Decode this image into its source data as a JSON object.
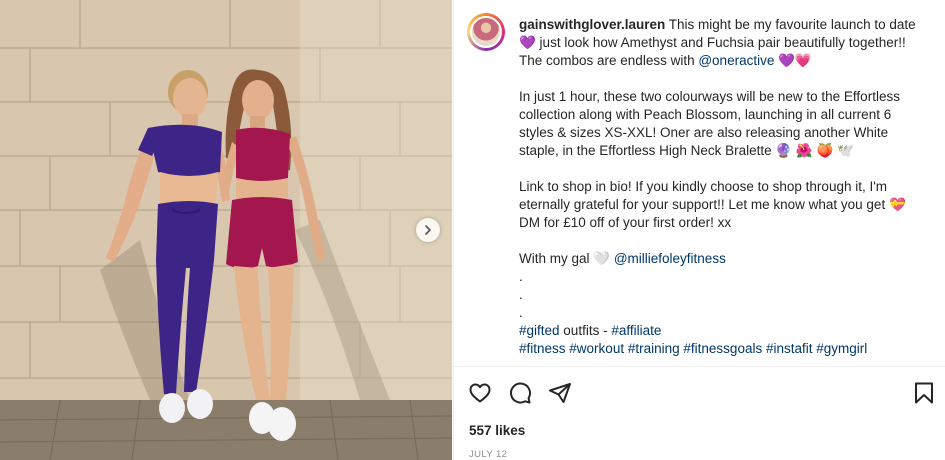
{
  "post": {
    "username": "gainswithglover.lauren",
    "caption_p1_text": " This might be my favourite launch to date 💜 just look how Amethyst and Fuchsia pair beautifully together!! The combos are endless with ",
    "mention_oner": "@oneractive",
    "caption_p1_end": " 💜💗",
    "caption_p2": "In just 1 hour, these two colourways will be new to the Effortless collection along with Peach Blossom, launching in all current 6 styles & sizes XS-XXL! Oner are also releasing another White staple, in the Effortless High Neck Bralette 🔮 🌺 🍑 🕊️",
    "caption_p3": "Link to shop in bio! If you kindly choose to shop through it, I'm eternally grateful for your support!! Let me know what you get 💝 DM for £10 off of your first order! xx",
    "gal_text": "With my gal 🤍 ",
    "mention_millie": "@milliefoleyfitness",
    "dot_1": ".",
    "dot_2": ".",
    "dot_3": ".",
    "tag_gifted": "#gifted",
    "gifted_mid": " outfits - ",
    "tag_affiliate": "#affiliate",
    "tags": [
      "#fitness",
      "#workout",
      "#training",
      "#fitnessgoals",
      "#instafit",
      "#gymgirl"
    ],
    "likes": "557 likes",
    "date": "JULY 12"
  },
  "icons": {
    "like": "heart-icon",
    "comment": "comment-icon",
    "share": "paper-plane-icon",
    "save": "bookmark-icon",
    "next": "chevron-right-icon"
  },
  "colors": {
    "link": "#00376b",
    "text": "#262626",
    "muted": "#8e8e8e",
    "amethyst": "#3d2587",
    "fuchsia": "#a3174e"
  }
}
